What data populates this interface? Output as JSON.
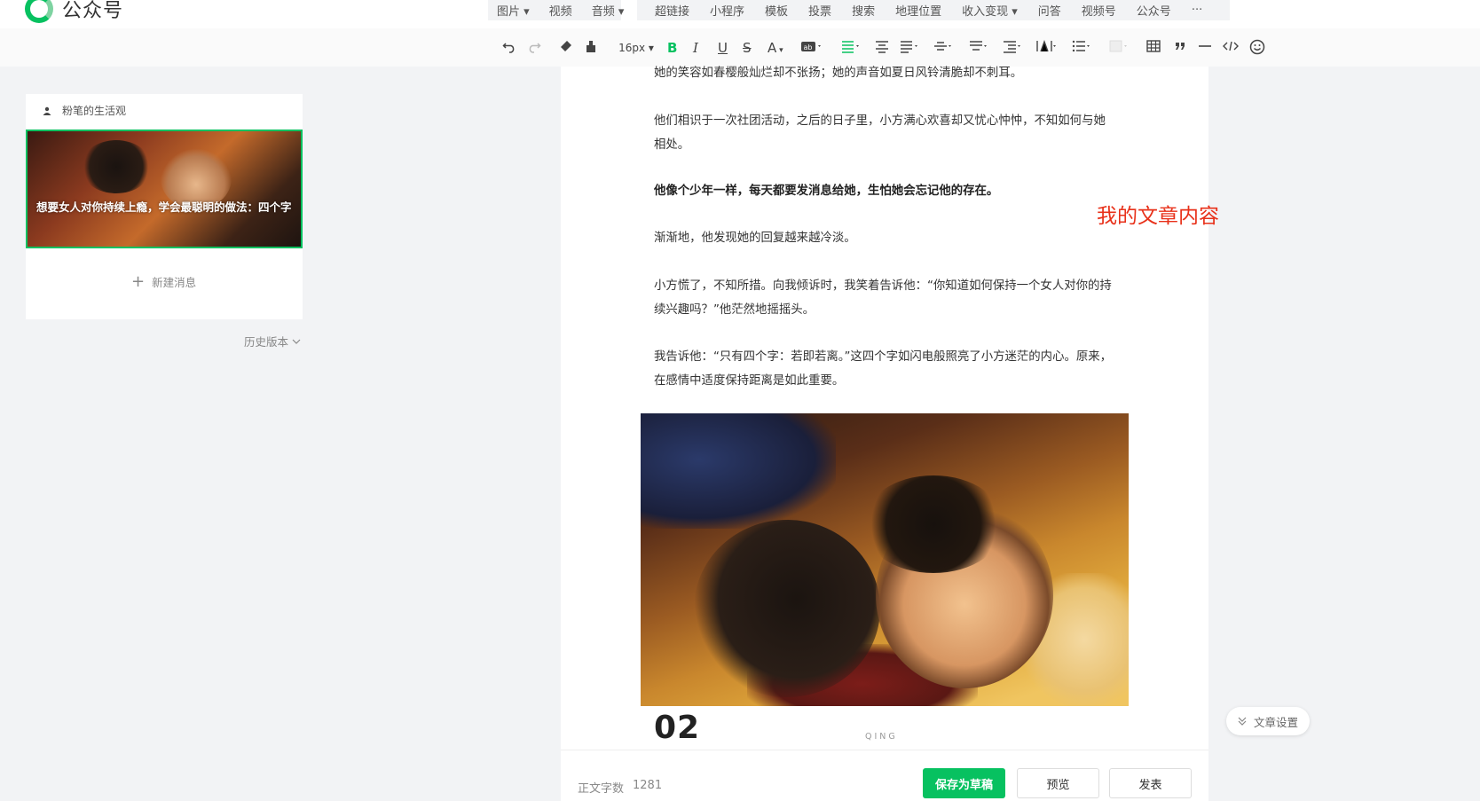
{
  "app": {
    "name": "公众号"
  },
  "media_left": [
    "图片 ▾",
    "视频",
    "音频 ▾"
  ],
  "media_right": [
    "超链接",
    "小程序",
    "模板",
    "投票",
    "搜索",
    "地理位置",
    "收入变现 ▾",
    "问答",
    "视频号",
    "公众号",
    "···"
  ],
  "toolbar": {
    "font_size": "16px",
    "bold": "B",
    "italic": "I",
    "underline": "U",
    "strike": "S",
    "font_color": "A"
  },
  "sidebar": {
    "account_name": "粉笔的生活观",
    "article_title": "想要女人对你持续上瘾，学会最聪明的做法：四个字",
    "new_message": "新建消息",
    "history": "历史版本"
  },
  "article": {
    "paragraphs": [
      "她的笑容如春樱般灿烂却不张扬；她的声音如夏日风铃清脆却不刺耳。",
      "他们相识于一次社团活动，之后的日子里，小方满心欢喜却又忧心忡忡，不知如何与她相处。",
      "他像个少年一样，每天都要发消息给她，生怕她会忘记他的存在。",
      "渐渐地，他发现她的回复越来越冷淡。",
      "小方慌了，不知所措。向我倾诉时，我笑着告诉他：“你知道如何保持一个女人对你的持续兴趣吗？”他茫然地摇摇头。",
      "我告诉他：“只有四个字：若即若离。”这四个字如闪电般照亮了小方迷茫的内心。原来，在感情中适度保持距离是如此重要。"
    ],
    "annotation": "我的文章内容",
    "section_number": "02",
    "section_tag": "QING"
  },
  "footer": {
    "word_count_label": "正文字数",
    "word_count_value": "1281",
    "save_label": "保存为草稿",
    "preview_label": "预览",
    "publish_label": "发表"
  },
  "settings_label": "文章设置",
  "colors": {
    "brand_green": "#07c160",
    "annotation_red": "#e8311a"
  }
}
